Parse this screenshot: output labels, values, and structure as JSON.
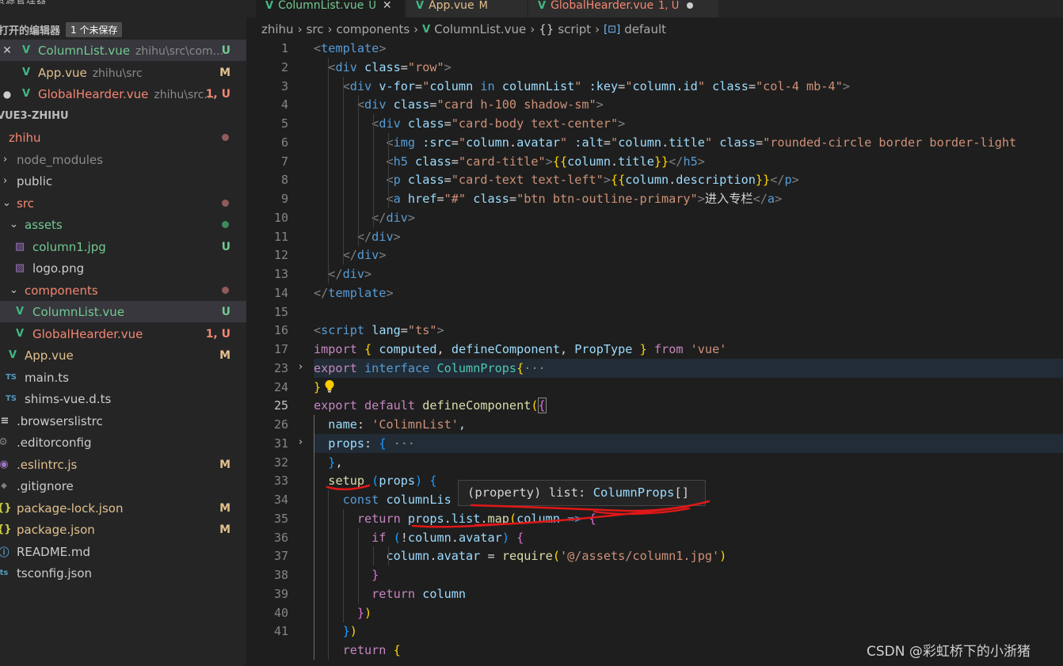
{
  "sidebar": {
    "title": "资源管理器",
    "more_glyph": "···",
    "open_editors": {
      "label": "打开的编辑器",
      "badge": "1 个未保存"
    },
    "open_files": [
      {
        "name": "ColumnList.vue",
        "path": "zhihu\\src\\com...",
        "status": "U",
        "lead": "✕"
      },
      {
        "name": "App.vue",
        "path": "zhihu\\src",
        "status": "M",
        "lead": ""
      },
      {
        "name": "GlobalHearder.vue",
        "path": "zhihu\\src...",
        "status": "1, U",
        "lead": "●"
      }
    ],
    "project": {
      "label": "VUE3-ZHIHU"
    },
    "tree": [
      {
        "name": "zhihu",
        "icon": "",
        "status": "",
        "dot": "#8f5b5b"
      },
      {
        "name": "node_modules",
        "icon": "›",
        "status": ""
      },
      {
        "name": "public",
        "icon": "›",
        "status": ""
      },
      {
        "name": "src",
        "icon": "⌄",
        "status": "",
        "dot": "#8f5b5b"
      },
      {
        "name": "assets",
        "icon": "⌄",
        "status": "",
        "dot": "#3c8c5a"
      },
      {
        "name": "column1.jpg",
        "icon": "image",
        "status": "U"
      },
      {
        "name": "logo.png",
        "icon": "image",
        "status": ""
      },
      {
        "name": "components",
        "icon": "⌄",
        "status": "",
        "dot": "#8f5b5b"
      },
      {
        "name": "ColumnList.vue",
        "icon": "V",
        "status": "U"
      },
      {
        "name": "GlobalHearder.vue",
        "icon": "V",
        "status": "1, U"
      },
      {
        "name": "App.vue",
        "icon": "V",
        "status": "M"
      },
      {
        "name": "main.ts",
        "icon": "TS",
        "status": ""
      },
      {
        "name": "shims-vue.d.ts",
        "icon": "TS",
        "status": ""
      },
      {
        "name": ".browserslistrc",
        "icon": "≡",
        "status": ""
      },
      {
        "name": ".editorconfig",
        "icon": "⚙",
        "status": ""
      },
      {
        "name": ".eslintrc.js",
        "icon": "◉",
        "status": "M"
      },
      {
        "name": ".gitignore",
        "icon": "◆",
        "status": ""
      },
      {
        "name": "package-lock.json",
        "icon": "{}",
        "status": "M"
      },
      {
        "name": "package.json",
        "icon": "{}",
        "status": "M"
      },
      {
        "name": "README.md",
        "icon": "ⓘ",
        "status": ""
      },
      {
        "name": "tsconfig.json",
        "icon": "ts",
        "status": ""
      }
    ]
  },
  "tabs": [
    {
      "name": "ColumnList.vue",
      "status": "U",
      "close": "✕"
    },
    {
      "name": "App.vue",
      "status": "M"
    },
    {
      "name": "GlobalHearder.vue",
      "status": "1, U"
    }
  ],
  "breadcrumb": {
    "parts": [
      "zhihu",
      "src",
      "components"
    ],
    "file": "ColumnList.vue",
    "section": "script",
    "symbol": "default",
    "section_glyph": "{}",
    "symbol_glyph": "[⊡]"
  },
  "editor": {
    "line_numbers": [
      "1",
      "2",
      "3",
      "4",
      "5",
      "6",
      "7",
      "8",
      "9",
      "10",
      "11",
      "12",
      "13",
      "14",
      "15",
      "16",
      "17",
      "23",
      "24",
      "25",
      "26",
      "31",
      "32",
      "33",
      "34",
      "35",
      "36",
      "37",
      "38",
      "39",
      "40",
      "41"
    ],
    "tooltip": {
      "paren_open": "(",
      "kind": "property",
      "paren_close": ")",
      "name": "list:",
      "type": "ColumnProps",
      "suffix": "[]"
    }
  },
  "watermark": "CSDN @彩虹桥下的小浙猪"
}
